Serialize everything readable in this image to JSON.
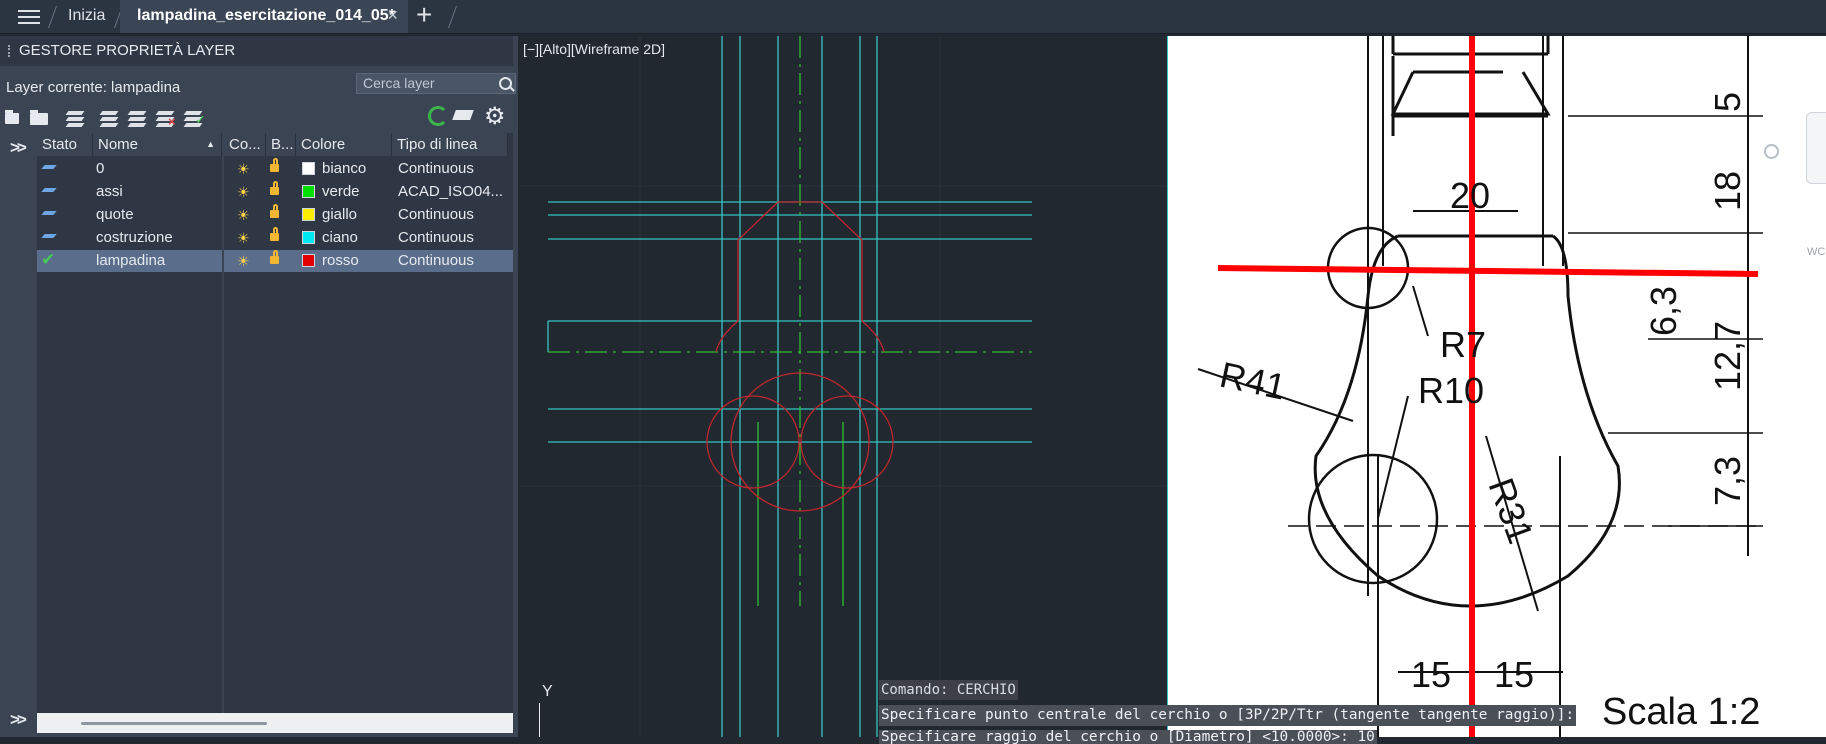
{
  "app": {
    "menu_icon": "hamburger-icon",
    "tabs": [
      {
        "label": "Inizia"
      },
      {
        "label": "lampadina_esercitazione_014_05*",
        "close": "×",
        "active": true
      }
    ],
    "new_tab": "+"
  },
  "layer_panel": {
    "title": "GESTORE PROPRIETÀ LAYER",
    "current_layer": "Layer corrente: lampadina",
    "search_placeholder": "Cerca layer",
    "columns": [
      "Stato",
      "Nome",
      "Co...",
      "B...",
      "Colore",
      "Tipo di linea"
    ],
    "layers": [
      {
        "name": "0",
        "color_name": "bianco",
        "color_hex": "#ffffff",
        "linetype": "Continuous",
        "current": false
      },
      {
        "name": "assi",
        "color_name": "verde",
        "color_hex": "#00e000",
        "linetype": "ACAD_ISO04...",
        "current": false
      },
      {
        "name": "quote",
        "color_name": "giallo",
        "color_hex": "#ffee00",
        "linetype": "Continuous",
        "current": false
      },
      {
        "name": "costruzione",
        "color_name": "ciano",
        "color_hex": "#00e8f0",
        "linetype": "Continuous",
        "current": false
      },
      {
        "name": "lampadina",
        "color_name": "rosso",
        "color_hex": "#e00000",
        "linetype": "Continuous",
        "current": true
      }
    ],
    "expand_icon": "double-chevron-right-icon"
  },
  "viewport": {
    "controls": {
      "minus": "[−]",
      "view": "[Alto]",
      "style": "[Wireframe 2D]"
    },
    "ucs_label": "Y"
  },
  "reference_drawing": {
    "dimensions": [
      "5",
      "18",
      "20",
      "6,3",
      "12,7",
      "7,3",
      "15",
      "15"
    ],
    "radii": [
      "R41",
      "R7",
      "R10",
      "R31"
    ],
    "scale": "Scala  1:2"
  },
  "command_line": {
    "line1": "Comando:  CERCHIO",
    "line2": "Specificare punto centrale del cerchio o [3P/2P/Ttr (tangente tangente raggio)]:",
    "line3": "Specificare raggio del cerchio o [Diametro] <10.0000>: 10"
  },
  "colors": {
    "construction": "#35c4c4",
    "axis": "#2fbf2f",
    "object": "#c0262c",
    "reference_mark": "#ff0000"
  }
}
